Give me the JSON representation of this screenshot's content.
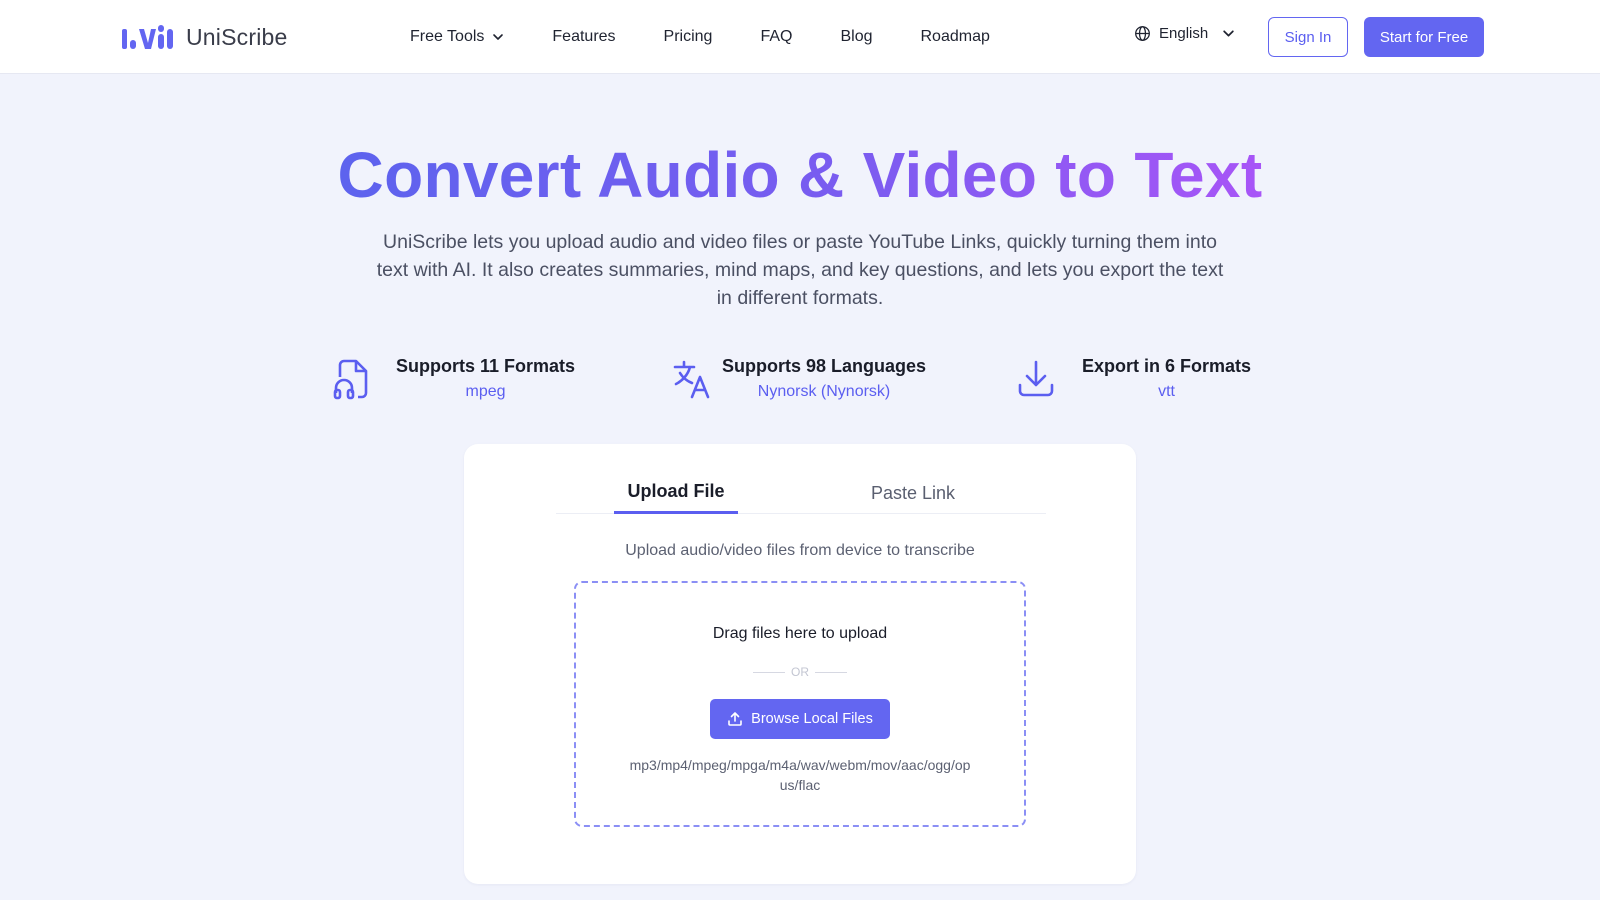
{
  "header": {
    "brand": "UniScribe",
    "nav": [
      "Free Tools",
      "Features",
      "Pricing",
      "FAQ",
      "Blog",
      "Roadmap"
    ],
    "language": "English",
    "sign_in": "Sign In",
    "start_free": "Start for Free"
  },
  "hero": {
    "title": "Convert Audio & Video to Text",
    "subtitle": "UniScribe lets you upload audio and video files or paste YouTube Links, quickly turning them into text with AI. It also creates summaries, mind maps, and key questions, and lets you export the text in different formats."
  },
  "features": [
    {
      "title": "Supports 11 Formats",
      "sub": "mpeg",
      "icon": "file-music-icon"
    },
    {
      "title": "Supports 98 Languages",
      "sub": "Nynorsk (Nynorsk)",
      "icon": "translate-icon"
    },
    {
      "title": "Export in 6 Formats",
      "sub": "vtt",
      "icon": "download-icon"
    }
  ],
  "upload": {
    "tabs": [
      "Upload File",
      "Paste Link"
    ],
    "active_tab": "Upload File",
    "description": "Upload audio/video files from device to transcribe",
    "drag_text": "Drag files here to upload",
    "or_text": "OR",
    "browse_label": "Browse Local Files",
    "formats": "mp3/mp4/mpeg/mpga/m4a/wav/webm/mov/aac/ogg/opus/flac"
  },
  "colors": {
    "accent": "#6366f1",
    "background": "#f1f3fc",
    "gradient_end": "#a855f7"
  }
}
